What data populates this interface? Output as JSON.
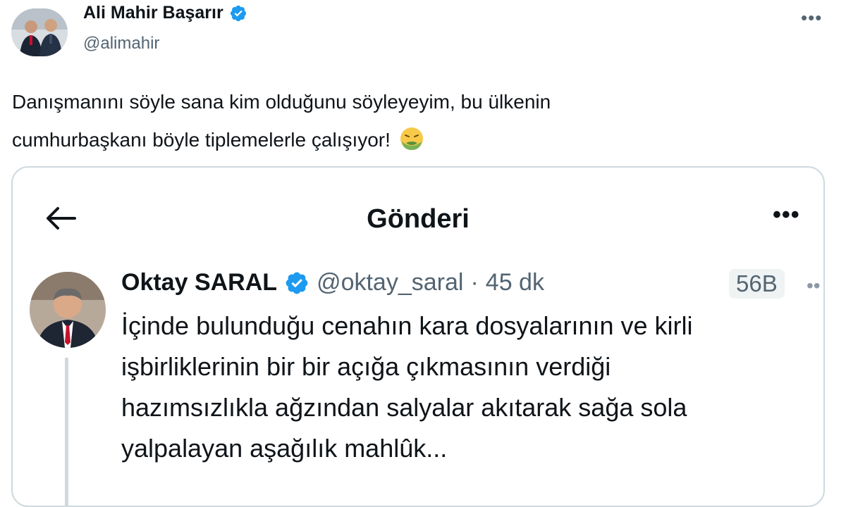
{
  "tweet": {
    "author_name": "Ali Mahir Başarır",
    "author_handle": "@alimahir",
    "more_icon": "more-horizontal-icon",
    "text_line1": "Danışmanını söyle sana kim olduğunu söyleyeyim, bu ülkenin",
    "text_line2": "cumhurbaşkanı böyle tiplemelerle çalışıyor!",
    "emoji": "nauseated-face-emoji"
  },
  "embedded_screenshot": {
    "header_title": "Gönderi",
    "back_icon": "arrow-left-icon",
    "more_icon": "more-horizontal-icon",
    "post": {
      "author_name": "Oktay SARAL",
      "author_handle": "@oktay_saral",
      "separator": "·",
      "time": "45 dk",
      "view_count": "56B",
      "text": [
        "İçinde bulunduğu cenahın kara dosyalarının ve kirli",
        "işbirliklerinin bir bir açığa çıkmasının verdiği",
        "hazımsızlıkla ağzından salyalar akıtarak sağa sola",
        "yalpalayan aşağılık mahlûk..."
      ]
    }
  },
  "colors": {
    "verified_blue": "#1d9bf0",
    "secondary_text": "#536471",
    "border": "#cfd9de"
  }
}
